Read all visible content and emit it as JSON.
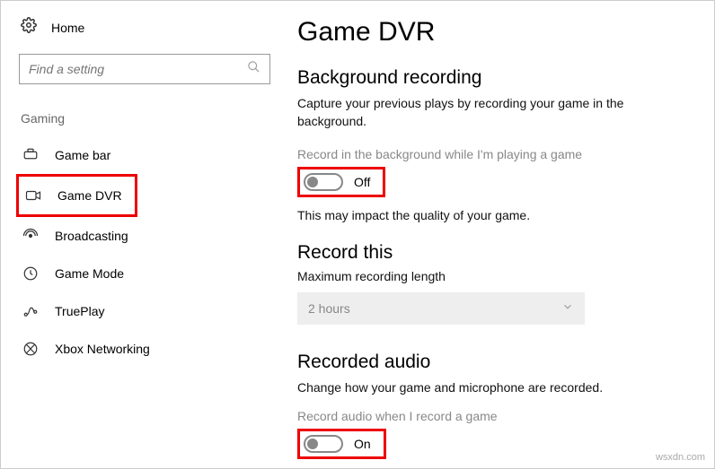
{
  "sidebar": {
    "home": "Home",
    "search_placeholder": "Find a setting",
    "category": "Gaming",
    "items": [
      {
        "label": "Game bar"
      },
      {
        "label": "Game DVR"
      },
      {
        "label": "Broadcasting"
      },
      {
        "label": "Game Mode"
      },
      {
        "label": "TruePlay"
      },
      {
        "label": "Xbox Networking"
      }
    ]
  },
  "main": {
    "title": "Game DVR",
    "bg_rec": {
      "title": "Background recording",
      "desc": "Capture your previous plays by recording your game in the background.",
      "toggle_label": "Record in the background while I'm playing a game",
      "toggle_state": "Off",
      "impact": "This may impact the quality of your game."
    },
    "record_this": {
      "title": "Record this",
      "field": "Maximum recording length",
      "value": "2 hours"
    },
    "audio": {
      "title": "Recorded audio",
      "desc": "Change how your game and microphone are recorded.",
      "toggle_label": "Record audio when I record a game",
      "toggle_state": "On"
    }
  },
  "watermark": "wsxdn.com"
}
